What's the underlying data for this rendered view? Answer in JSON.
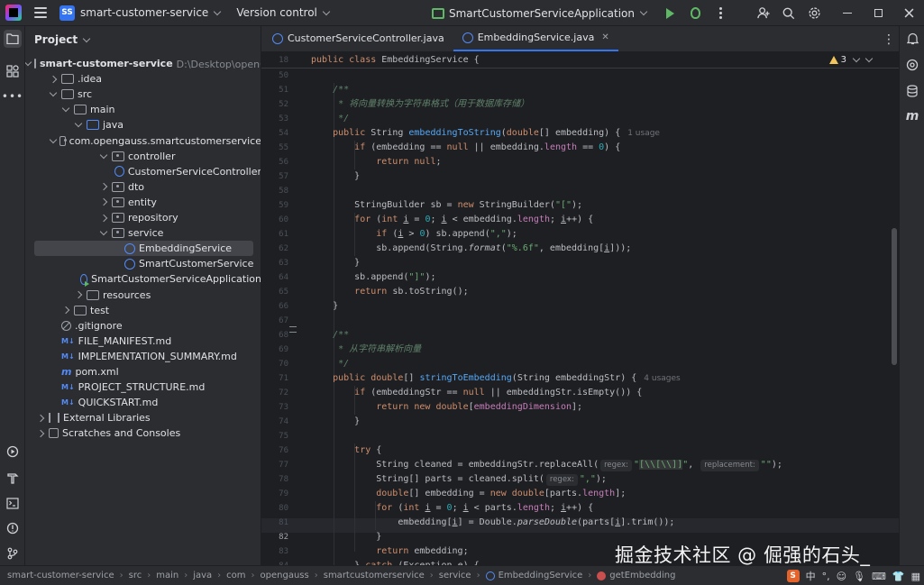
{
  "titlebar": {
    "project_badge": "SS",
    "project_name": "smart-customer-service",
    "vcs": "Version control",
    "run_config": "SmartCustomerServiceApplication"
  },
  "project_panel": {
    "title": "Project",
    "root_path": "D:\\Desktop\\openGauss赋能智",
    "items": [
      {
        "label": "smart-customer-service",
        "depth": 0,
        "arrow": "d",
        "icon": "folder",
        "bold": true
      },
      {
        "label": ".idea",
        "depth": 1,
        "arrow": "r",
        "icon": "folder"
      },
      {
        "label": "src",
        "depth": 1,
        "arrow": "d",
        "icon": "folder"
      },
      {
        "label": "main",
        "depth": 2,
        "arrow": "d",
        "icon": "folder"
      },
      {
        "label": "java",
        "depth": 3,
        "arrow": "d",
        "icon": "folder-blue"
      },
      {
        "label": "com.opengauss.smartcustomerservice",
        "depth": 4,
        "arrow": "d",
        "icon": "pkg"
      },
      {
        "label": "controller",
        "depth": 5,
        "arrow": "d",
        "icon": "pkg"
      },
      {
        "label": "CustomerServiceController",
        "depth": 6,
        "arrow": "n",
        "icon": "cls"
      },
      {
        "label": "dto",
        "depth": 5,
        "arrow": "r",
        "icon": "pkg"
      },
      {
        "label": "entity",
        "depth": 5,
        "arrow": "r",
        "icon": "pkg"
      },
      {
        "label": "repository",
        "depth": 5,
        "arrow": "r",
        "icon": "pkg"
      },
      {
        "label": "service",
        "depth": 5,
        "arrow": "d",
        "icon": "pkg"
      },
      {
        "label": "EmbeddingService",
        "depth": 6,
        "arrow": "n",
        "icon": "cls",
        "selected": true
      },
      {
        "label": "SmartCustomerService",
        "depth": 6,
        "arrow": "n",
        "icon": "cls"
      },
      {
        "label": "SmartCustomerServiceApplication",
        "depth": 5,
        "arrow": "n",
        "icon": "cls-run"
      },
      {
        "label": "resources",
        "depth": 3,
        "arrow": "r",
        "icon": "folder"
      },
      {
        "label": "test",
        "depth": 2,
        "arrow": "r",
        "icon": "folder"
      },
      {
        "label": ".gitignore",
        "depth": 1,
        "arrow": "n",
        "icon": "ignore"
      },
      {
        "label": "FILE_MANIFEST.md",
        "depth": 1,
        "arrow": "n",
        "icon": "md"
      },
      {
        "label": "IMPLEMENTATION_SUMMARY.md",
        "depth": 1,
        "arrow": "n",
        "icon": "md"
      },
      {
        "label": "pom.xml",
        "depth": 1,
        "arrow": "n",
        "icon": "m"
      },
      {
        "label": "PROJECT_STRUCTURE.md",
        "depth": 1,
        "arrow": "n",
        "icon": "md"
      },
      {
        "label": "QUICKSTART.md",
        "depth": 1,
        "arrow": "n",
        "icon": "md"
      },
      {
        "label": "External Libraries",
        "depth": 0,
        "arrow": "r",
        "icon": "lib"
      },
      {
        "label": "Scratches and Consoles",
        "depth": 0,
        "arrow": "r",
        "icon": "scratch"
      }
    ]
  },
  "icons": {
    "md_glyph": "M↓",
    "m_glyph": "m",
    "right_m": "m",
    "tab_more": "⋮",
    "status_cn": "中"
  },
  "tabs": [
    {
      "label": "CustomerServiceController.java",
      "active": false
    },
    {
      "label": "EmbeddingService.java",
      "active": true
    }
  ],
  "editor": {
    "sticky_line_no": "18",
    "warning_count": "3",
    "current_line": "82",
    "line_numbers": [
      "50",
      "51",
      "52",
      "53",
      "54",
      "55",
      "56",
      "57",
      "58",
      "59",
      "60",
      "61",
      "62",
      "63",
      "64",
      "65",
      "66",
      "67",
      "68",
      "69",
      "70",
      "71",
      "72",
      "73",
      "74",
      "75",
      "76",
      "77",
      "78",
      "79",
      "80",
      "81",
      "82",
      "83",
      "84"
    ],
    "hints": {
      "usage_1": "1 usage",
      "usage_4": "4 usages",
      "regex": "regex:",
      "replacement": "replacement:"
    }
  },
  "statusbar": {
    "breadcrumbs": [
      "smart-customer-service",
      "src",
      "main",
      "java",
      "com",
      "opengauss",
      "smartcustomerservice",
      "service",
      "EmbeddingService",
      "getEmbedding"
    ]
  },
  "watermark": "掘金技术社区 @ 倔强的石头_",
  "colors": {
    "accent": "#3574f0",
    "keyword": "#cf8e6d",
    "function": "#56a8f5",
    "string": "#6aab73",
    "number": "#2aacb8",
    "field": "#c77dbb",
    "comment": "#7a7e85"
  }
}
